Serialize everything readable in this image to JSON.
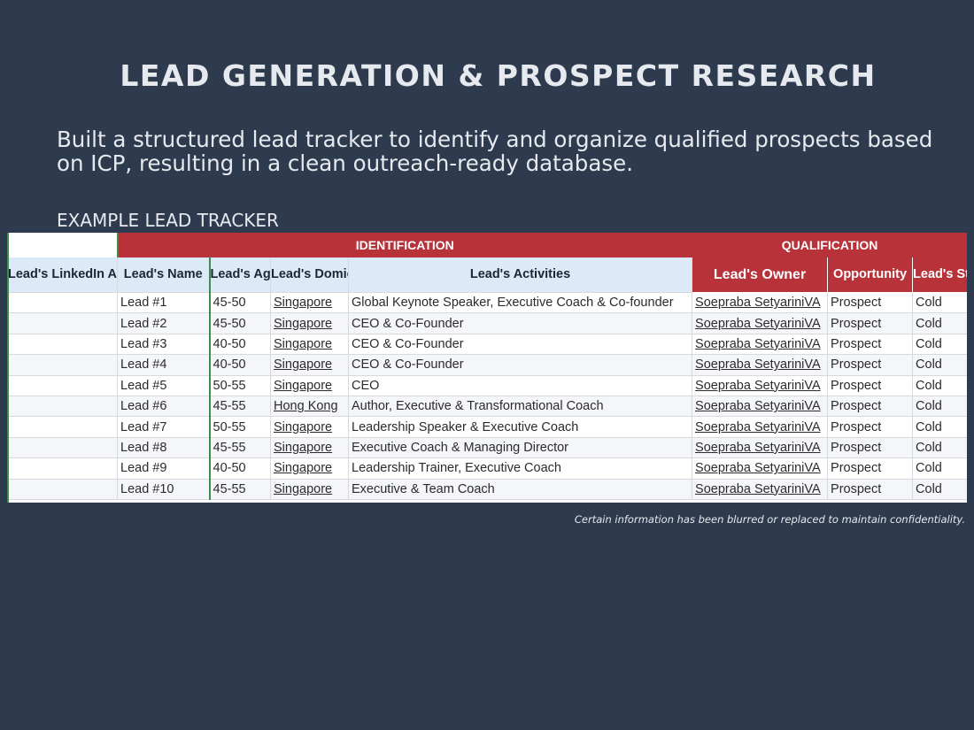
{
  "slide": {
    "title": "LEAD GENERATION & PROSPECT RESEARCH",
    "subtitle": "Built a structured lead tracker to identify and organize qualified prospects based on ICP, resulting in a clean outreach-ready database.",
    "section_label": "EXAMPLE LEAD TRACKER",
    "note": "Certain information has been blurred or replaced to maintain confidentiality."
  },
  "tracker": {
    "group_headers": {
      "identification": "IDENTIFICATION",
      "qualification": "QUALIFICATION"
    },
    "columns": {
      "linkedin": "Lead's LinkedIn Account",
      "name": "Lead's Name",
      "ages": "Lead's Ages",
      "domicile": "Lead's Domicile",
      "activities": "Lead's Activities",
      "owner": "Lead's Owner",
      "opportunity": "Opportunity",
      "status": "Lead's Status"
    },
    "rows": [
      {
        "linkedin": "",
        "name": "Lead #1",
        "ages": "45-50",
        "domicile": "Singapore",
        "activities": "Global Keynote Speaker, Executive Coach & Co-founder",
        "owner": "Soepraba SetyariniVA",
        "opportunity": "Prospect",
        "status": "Cold"
      },
      {
        "linkedin": "",
        "name": "Lead #2",
        "ages": "45-50",
        "domicile": "Singapore",
        "activities": "CEO & Co-Founder",
        "owner": "Soepraba SetyariniVA",
        "opportunity": "Prospect",
        "status": "Cold"
      },
      {
        "linkedin": "",
        "name": "Lead #3",
        "ages": "40-50",
        "domicile": "Singapore",
        "activities": "CEO & Co-Founder",
        "owner": "Soepraba SetyariniVA",
        "opportunity": "Prospect",
        "status": "Cold"
      },
      {
        "linkedin": "",
        "name": "Lead #4",
        "ages": "40-50",
        "domicile": "Singapore",
        "activities": "CEO & Co-Founder",
        "owner": "Soepraba SetyariniVA",
        "opportunity": "Prospect",
        "status": "Cold"
      },
      {
        "linkedin": "",
        "name": "Lead #5",
        "ages": "50-55",
        "domicile": "Singapore",
        "activities": "CEO",
        "owner": "Soepraba SetyariniVA",
        "opportunity": "Prospect",
        "status": "Cold"
      },
      {
        "linkedin": "",
        "name": "Lead #6",
        "ages": "45-55",
        "domicile": "Hong Kong",
        "activities": "Author, Executive & Transformational Coach",
        "owner": "Soepraba SetyariniVA",
        "opportunity": "Prospect",
        "status": "Cold"
      },
      {
        "linkedin": "",
        "name": "Lead #7",
        "ages": "50-55",
        "domicile": "Singapore",
        "activities": "Leadership Speaker & Executive Coach",
        "owner": "Soepraba SetyariniVA",
        "opportunity": "Prospect",
        "status": "Cold"
      },
      {
        "linkedin": "",
        "name": "Lead #8",
        "ages": "45-55",
        "domicile": "Singapore",
        "activities": "Executive Coach & Managing Director",
        "owner": "Soepraba SetyariniVA",
        "opportunity": "Prospect",
        "status": "Cold"
      },
      {
        "linkedin": "",
        "name": "Lead #9",
        "ages": "40-50",
        "domicile": "Singapore",
        "activities": "Leadership Trainer, Executive Coach",
        "owner": "Soepraba SetyariniVA",
        "opportunity": "Prospect",
        "status": "Cold"
      },
      {
        "linkedin": "",
        "name": "Lead #10",
        "ages": "45-55",
        "domicile": "Singapore",
        "activities": "Executive & Team Coach",
        "owner": "Soepraba SetyariniVA",
        "opportunity": "Prospect",
        "status": "Cold"
      }
    ],
    "colors": {
      "header_red": "#b8323a",
      "header_blue": "#dce9f6",
      "slide_bg": "#2e3b4e"
    }
  }
}
